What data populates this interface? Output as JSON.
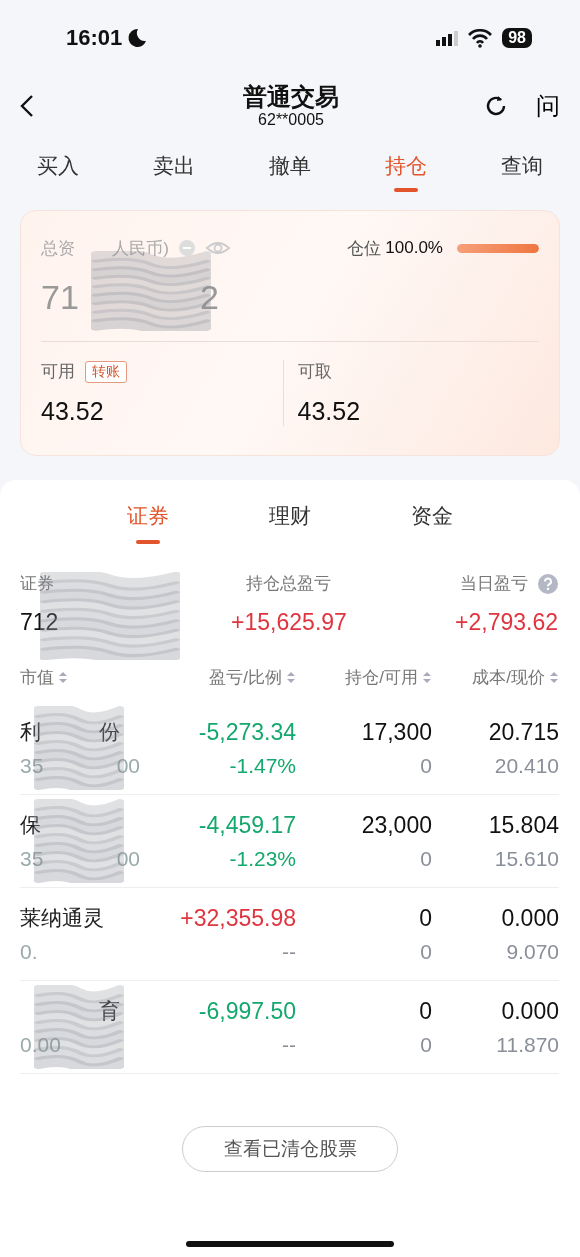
{
  "status_bar": {
    "time": "16:01",
    "battery": "98"
  },
  "header": {
    "title": "普通交易",
    "account": "62**0005",
    "help": "问"
  },
  "tabs": [
    {
      "label": "买入",
      "selected": false
    },
    {
      "label": "卖出",
      "selected": false
    },
    {
      "label": "撤单",
      "selected": false
    },
    {
      "label": "持仓",
      "selected": true
    },
    {
      "label": "查询",
      "selected": false
    }
  ],
  "asset_card": {
    "total_label": {
      "start": "总资",
      "end": "人民币)"
    },
    "total_value": {
      "start": "71",
      "end": "2"
    },
    "position": {
      "label": "仓位",
      "value": "100.0%",
      "level": 1
    },
    "available": {
      "label": "可用",
      "badge": "转账",
      "value": "43.52"
    },
    "withdrawable": {
      "label": "可取",
      "value": "43.52"
    }
  },
  "sub_tabs": [
    {
      "label": "证券",
      "selected": true
    },
    {
      "label": "理财",
      "selected": false
    },
    {
      "label": "资金",
      "selected": false
    }
  ],
  "summary": {
    "securities": {
      "label": {
        "start": "证券"
      },
      "value": {
        "start": "712"
      }
    },
    "total_pnl": {
      "label": "持仓总盈亏",
      "value": "+15,625.97",
      "color": "#e0343f"
    },
    "daily_pnl": {
      "label": "当日盈亏",
      "value": "+2,793.62",
      "color": "#e0343f"
    }
  },
  "columns": [
    {
      "label": "市值"
    },
    {
      "label": "盈亏/比例"
    },
    {
      "label": "持仓/可用"
    },
    {
      "label": "成本/现价"
    }
  ],
  "rows": [
    {
      "name": {
        "start": "利",
        "end": "份"
      },
      "market_value": {
        "start": "35",
        "end": "00"
      },
      "redacted": true,
      "pnl": "-5,273.34",
      "ratio": "-1.47%",
      "color": "#15a86e",
      "holding": "17,300",
      "available": "0",
      "cost": "20.715",
      "price": "20.410"
    },
    {
      "name": {
        "start": "保"
      },
      "market_value": {
        "start": "35",
        "end": "00"
      },
      "redacted": true,
      "pnl": "-4,459.17",
      "ratio": "-1.23%",
      "color": "#15a86e",
      "holding": "23,000",
      "available": "0",
      "cost": "15.804",
      "price": "15.610"
    },
    {
      "name": {
        "start": "莱纳通灵"
      },
      "market_value": {
        "start": "0."
      },
      "redacted": false,
      "pnl": "+32,355.98",
      "ratio": "--",
      "color": "#e0343f",
      "holding": "0",
      "available": "0",
      "cost": "0.000",
      "price": "9.070"
    },
    {
      "name": {
        "end": "育"
      },
      "market_value": {
        "start": "0.00"
      },
      "redacted": true,
      "pnl": "-6,997.50",
      "ratio": "--",
      "color": "#15a86e",
      "holding": "0",
      "available": "0",
      "cost": "0.000",
      "price": "11.870"
    }
  ],
  "cleared_button": "查看已清仓股票"
}
